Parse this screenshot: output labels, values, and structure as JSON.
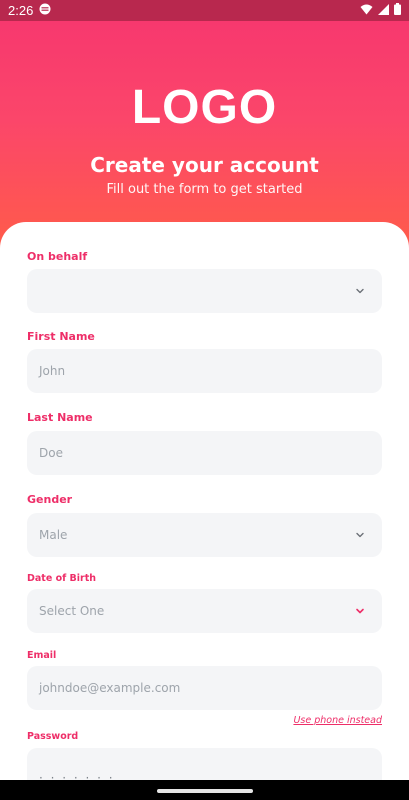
{
  "status_bar": {
    "time": "2:26",
    "icons": [
      "sync-icon",
      "wifi-icon",
      "signal-icon",
      "battery-icon"
    ]
  },
  "header": {
    "logo": "LOGO",
    "title": "Create your account",
    "subtitle": "Fill out the form to get started"
  },
  "form": {
    "on_behalf": {
      "label": "On behalf",
      "value": ""
    },
    "first_name": {
      "label": "First Name",
      "placeholder": "John"
    },
    "last_name": {
      "label": "Last Name",
      "placeholder": "Doe"
    },
    "gender": {
      "label": "Gender",
      "value": "Male"
    },
    "dob": {
      "label": "Date of Birth",
      "placeholder": "Select One"
    },
    "email": {
      "label": "Email",
      "placeholder": "johndoe@example.com",
      "alt_link": "Use phone instead"
    },
    "password": {
      "label": "Password",
      "masked": "· · · · · · ·"
    }
  },
  "colors": {
    "accent": "#ee2e68",
    "gradient_top": "#f6356f",
    "gradient_bottom": "#ff5a4c",
    "field_bg": "#f4f5f7"
  }
}
